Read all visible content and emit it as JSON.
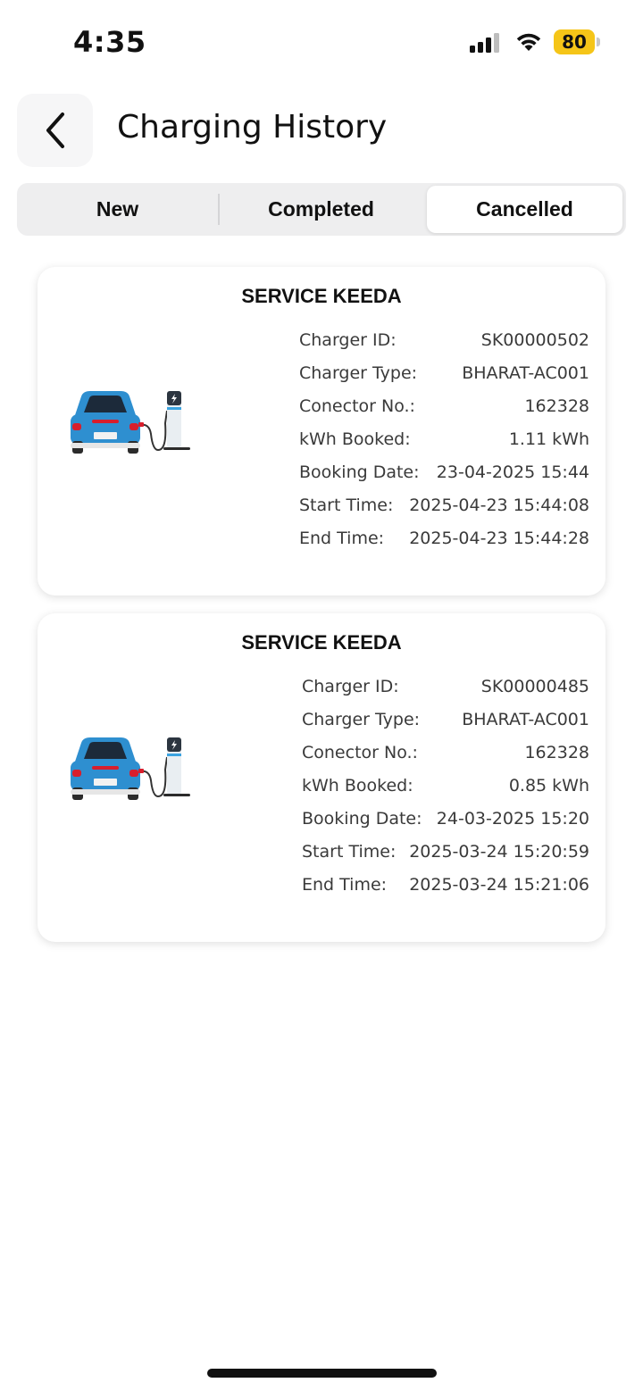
{
  "status_bar": {
    "time": "4:35",
    "battery": "80"
  },
  "header": {
    "title": "Charging History"
  },
  "tabs": [
    {
      "label": "New",
      "selected": false
    },
    {
      "label": "Completed",
      "selected": false
    },
    {
      "label": "Cancelled",
      "selected": true
    }
  ],
  "bookings": [
    {
      "station": "SERVICE KEEDA",
      "rows": [
        {
          "label": "Charger ID:",
          "value": "SK00000502"
        },
        {
          "label": "Charger Type:",
          "value": "BHARAT-AC001"
        },
        {
          "label": "Conector No.:",
          "value": "162328"
        },
        {
          "label": "kWh Booked:",
          "value": "1.11 kWh"
        },
        {
          "label": "Booking Date:",
          "value": "23-04-2025 15:44"
        },
        {
          "label": "Start Time:",
          "value": "2025-04-23 15:44:08"
        },
        {
          "label": "End Time:",
          "value": "2025-04-23 15:44:28"
        }
      ]
    },
    {
      "station": "SERVICE KEEDA",
      "rows": [
        {
          "label": "Charger ID:",
          "value": "SK00000485"
        },
        {
          "label": "Charger Type:",
          "value": "BHARAT-AC001"
        },
        {
          "label": "Conector No.:",
          "value": "162328"
        },
        {
          "label": "kWh Booked:",
          "value": "0.85 kWh"
        },
        {
          "label": "Booking Date:",
          "value": "24-03-2025 15:20"
        },
        {
          "label": "Start Time:",
          "value": "2025-03-24 15:20:59"
        },
        {
          "label": "End Time:",
          "value": "2025-03-24 15:21:06"
        }
      ]
    }
  ],
  "icons": {
    "back": "chevron-left-icon",
    "signal": "cellular-signal-icon",
    "wifi": "wifi-icon",
    "battery": "battery-icon",
    "card_image": "ev-car-charging-illustration"
  },
  "colors": {
    "battery": "#f5c518",
    "car": "#2e8fd0",
    "tab_track": "#eeeeef",
    "card_shadow": "rgba(0,0,0,0.13)"
  }
}
